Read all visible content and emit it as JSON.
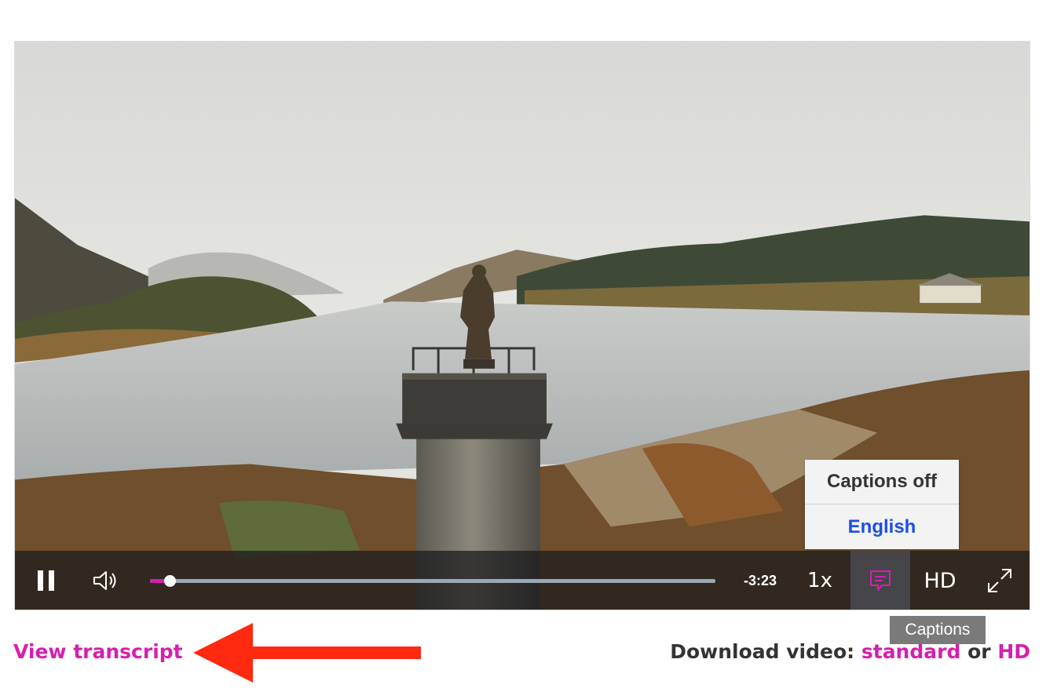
{
  "colors": {
    "accent": "#d61fae",
    "caption_selected": "#1c4ee6",
    "annotation_arrow": "#ff2a10"
  },
  "player": {
    "progress_fraction": 0.035,
    "time_remaining": "-3:23",
    "speed_label": "1x",
    "hd_label": "HD",
    "captions_tooltip": "Captions",
    "captions_menu": {
      "off_label": "Captions off",
      "english_label": "English",
      "selected": "English"
    },
    "icons": [
      "pause-icon",
      "volume-icon",
      "captions-icon",
      "fullscreen-icon"
    ]
  },
  "below": {
    "transcript_link": "View transcript",
    "download_prefix": "Download video:",
    "download_standard": "standard",
    "download_or": "or",
    "download_hd": "HD"
  }
}
